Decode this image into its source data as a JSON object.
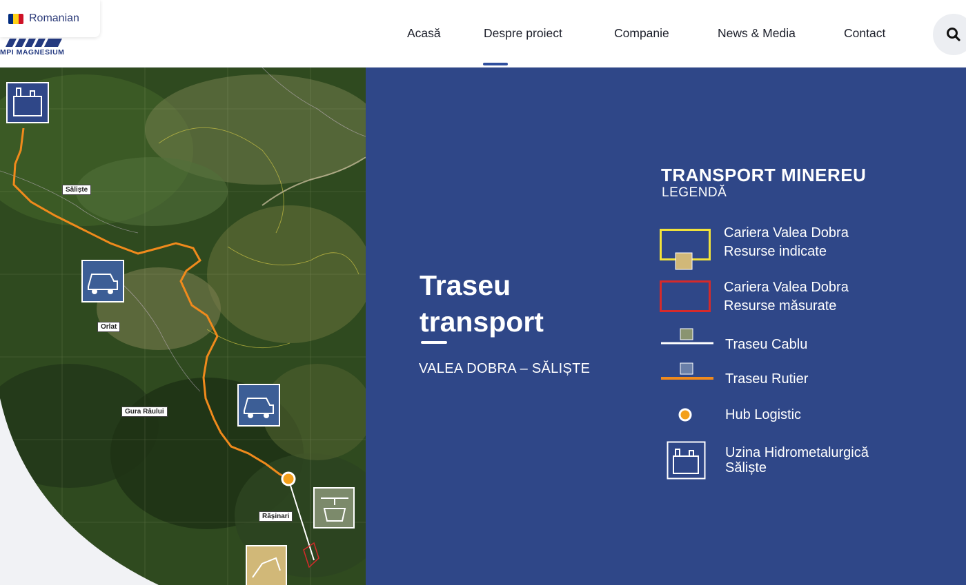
{
  "language": {
    "label": "Romanian",
    "flag_colors": [
      "#002B7F",
      "#FCD116",
      "#CE1126"
    ]
  },
  "logo": {
    "text": "MPI MAGNESIUM"
  },
  "nav": {
    "items": [
      {
        "label": "Acasă"
      },
      {
        "label": "Despre proiect"
      },
      {
        "label": "Companie"
      },
      {
        "label": "News & Media"
      },
      {
        "label": "Contact"
      }
    ],
    "active_index": 1
  },
  "search": {
    "icon": "search-icon"
  },
  "map": {
    "places": [
      "Săliște",
      "Orlat",
      "Gura Râului",
      "Rășinari"
    ],
    "icons": [
      "factory-icon",
      "dump-truck-icon",
      "dump-truck-icon",
      "cable-car-icon",
      "excavator-icon"
    ]
  },
  "hero": {
    "title_line1": "Traseu",
    "title_line2": "transport",
    "subtitle": "VALEA DOBRA – SĂLIȘTE"
  },
  "legend": {
    "title": "TRANSPORT MINEREU",
    "subtitle": "LEGENDĂ",
    "items": [
      {
        "line1": "Cariera Valea Dobra",
        "line2": "Resurse indicate",
        "symbol": "yellow-outline-box",
        "color": "#f2e33a"
      },
      {
        "line1": "Cariera Valea Dobra",
        "line2": "Resurse măsurate",
        "symbol": "red-outline-box",
        "color": "#d62a2a"
      },
      {
        "line1": "Traseu Cablu",
        "symbol": "white-line",
        "color": "#ffffff"
      },
      {
        "line1": "Traseu Rutier",
        "symbol": "orange-line",
        "color": "#f08a1c"
      },
      {
        "line1": "Hub Logistic",
        "symbol": "orange-dot",
        "color": "#f3a01b"
      },
      {
        "line1": "Uzina Hidrometalurgică",
        "line2": "Săliște",
        "symbol": "factory-icon"
      }
    ]
  },
  "colors": {
    "panel_bg": "#2f4788",
    "accent": "#2f4f9e",
    "route": "#f08a1c"
  }
}
